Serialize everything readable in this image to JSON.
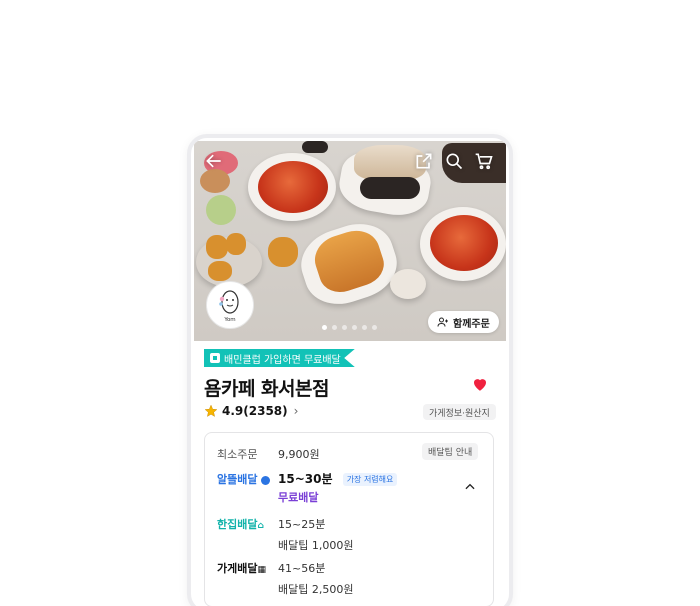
{
  "hero": {
    "together_order_label": "함께주문",
    "icons": [
      "back-arrow-icon",
      "share-icon",
      "search-icon",
      "cart-icon",
      "person-plus-icon"
    ],
    "carousel": {
      "total": 6,
      "active": 1
    }
  },
  "store": {
    "promo_label": "배민클럽 가입하면 무료배달",
    "name": "욤카페 화서본점",
    "rating": "4.9(2358)",
    "info_chip": "가게정보·원산지",
    "logo_text": "Yom",
    "favorited": true
  },
  "delivery": {
    "min_order_label": "최소주문",
    "min_order_value": "9,900원",
    "tip_info_button": "배달팁 안내",
    "options": [
      {
        "name": "알뜰배달",
        "time": "15~30분",
        "badge": "가장 저렴해요",
        "fee": "무료배달"
      },
      {
        "name": "한집배달",
        "time": "15~25분",
        "fee": "배달팁 1,000원"
      },
      {
        "name": "가게배달",
        "time": "41~56분",
        "fee": "배달팁 2,500원"
      }
    ]
  },
  "colors": {
    "promo_teal": "#12c2b7",
    "heart_red": "#f0213f",
    "star_gold": "#f7b500",
    "alttle_blue": "#2b74e2",
    "free_purple": "#7a3fd6"
  }
}
